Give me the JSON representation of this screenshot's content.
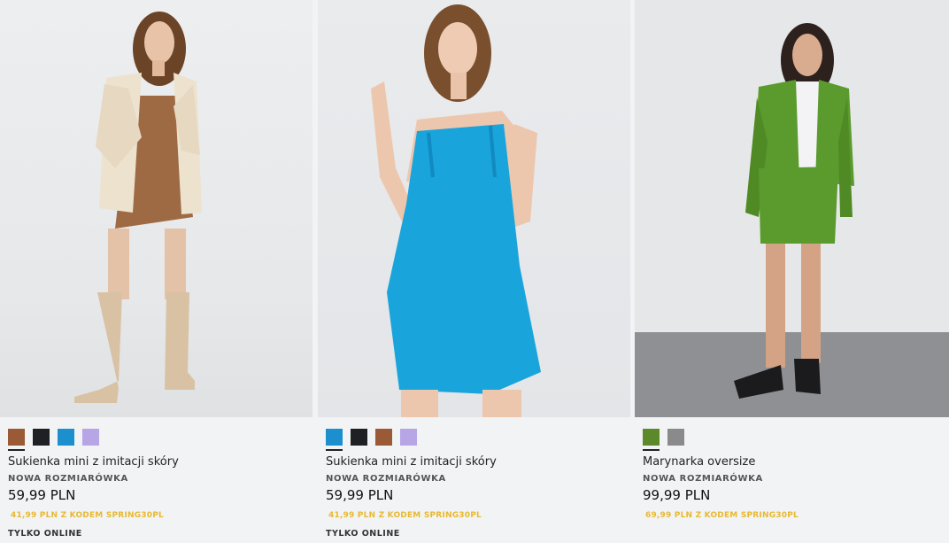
{
  "products": [
    {
      "title": "Sukienka mini z imitacji skóry",
      "badge": "NOWA ROZMIARÓWKA",
      "price": "59,99 PLN",
      "promo_price": "41,99 PLN",
      "promo_text": "Z KODEM",
      "promo_code": "SPRING30PL",
      "online": "TYLKO ONLINE",
      "swatches": [
        "#9a5a35",
        "#1e2024",
        "#1c8fcf",
        "#b8a5e6"
      ],
      "active_swatch": 0
    },
    {
      "title": "Sukienka mini z imitacji skóry",
      "badge": "NOWA ROZMIARÓWKA",
      "price": "59,99 PLN",
      "promo_price": "41,99 PLN",
      "promo_text": "Z KODEM",
      "promo_code": "SPRING30PL",
      "online": "TYLKO ONLINE",
      "swatches": [
        "#1c8fcf",
        "#1e2024",
        "#9a5a35",
        "#b8a5e6"
      ],
      "active_swatch": 0
    },
    {
      "title": "Marynarka oversize",
      "badge": "NOWA ROZMIARÓWKA",
      "price": "99,99 PLN",
      "promo_price": "69,99 PLN",
      "promo_text": "Z KODEM",
      "promo_code": "SPRING30PL",
      "swatches": [
        "#5c8a2a",
        "#8a8a8a"
      ],
      "active_swatch": 0
    }
  ],
  "colors": {
    "promo": "#e8b92f",
    "background": "#f2f3f5"
  }
}
